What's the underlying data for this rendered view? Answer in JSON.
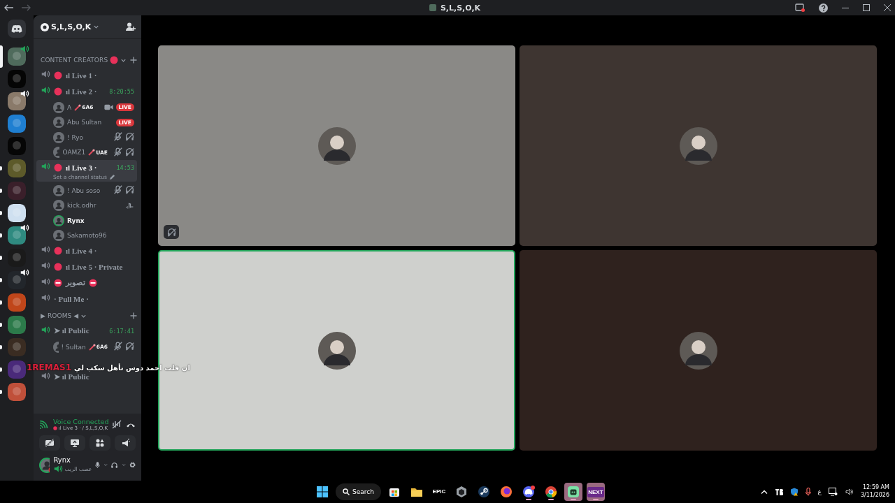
{
  "window": {
    "title": "S,L,S,O,K"
  },
  "server_rail": [
    {
      "color": "#4f6b5c",
      "selected": true,
      "unread": false,
      "voice": true
    },
    {
      "color": "#050505",
      "selected": false,
      "unread": false,
      "voice": false
    },
    {
      "color": "#8a7a6a",
      "selected": false,
      "unread": false,
      "voice": true
    },
    {
      "color": "#1f7fd1",
      "selected": false,
      "unread": false,
      "voice": false
    },
    {
      "color": "#060606",
      "selected": false,
      "unread": false,
      "voice": false
    },
    {
      "color": "#5d5a2a",
      "selected": false,
      "unread": true,
      "voice": false
    },
    {
      "color": "#3a1f2a",
      "selected": false,
      "unread": true,
      "voice": false
    },
    {
      "color": "#cfe0f0",
      "selected": false,
      "unread": true,
      "voice": false
    },
    {
      "color": "#2f8a80",
      "selected": false,
      "unread": true,
      "voice": true
    },
    {
      "color": "#1a1a1a",
      "selected": false,
      "unread": true,
      "voice": false
    },
    {
      "color": "#22262b",
      "selected": false,
      "unread": true,
      "voice": true
    },
    {
      "color": "#c0461a",
      "selected": false,
      "unread": true,
      "voice": false
    },
    {
      "color": "#2c7a4a",
      "selected": false,
      "unread": true,
      "voice": false
    },
    {
      "color": "#3a2c22",
      "selected": false,
      "unread": true,
      "voice": false
    },
    {
      "color": "#4a2a7a",
      "selected": false,
      "unread": true,
      "voice": false
    },
    {
      "color": "#c0503a",
      "selected": false,
      "unread": true,
      "voice": false
    }
  ],
  "server": {
    "name": "S,L,S,O,K"
  },
  "categories": [
    {
      "name": "CONTENT CREATORS",
      "dot": true,
      "channels": [
        {
          "kind": "voice",
          "name": "ıl Live 1 ·",
          "dot": true,
          "no_entry": false,
          "active": false,
          "selected": false
        },
        {
          "kind": "voice",
          "name": "ıl Live 2 ·",
          "dot": true,
          "no_entry": false,
          "active": true,
          "selected": false,
          "timer": "8:20:55",
          "members": [
            {
              "name": "A",
              "tag": "6A6",
              "video": true,
              "badge": "LIVE",
              "muted": false,
              "deafened": false,
              "console": false,
              "speaking": false
            },
            {
              "name": "Abu Sultan",
              "badge": "LIVE",
              "video": false,
              "muted": false,
              "deafened": false,
              "console": false,
              "speaking": false
            },
            {
              "name": "! Ryo",
              "video": false,
              "muted": true,
              "deafened": true,
              "console": false,
              "speaking": false
            },
            {
              "name": "OAMZ1",
              "tag": "UAE",
              "video": false,
              "muted": true,
              "deafened": true,
              "console": false,
              "speaking": false
            }
          ]
        },
        {
          "kind": "voice",
          "name": "ıl Live 3 ·",
          "dot": true,
          "no_entry": false,
          "active": true,
          "selected": true,
          "timer": "14:53",
          "status": "Set a channel status",
          "members": [
            {
              "name": "! Abu soso",
              "video": false,
              "muted": true,
              "deafened": true,
              "console": false,
              "speaking": false
            },
            {
              "name": "kick.odhr",
              "video": false,
              "muted": false,
              "deafened": false,
              "console": true,
              "speaking": false
            },
            {
              "name": "Rynx",
              "video": false,
              "muted": false,
              "deafened": false,
              "console": false,
              "speaking": true
            },
            {
              "name": "Sakamoto96",
              "video": false,
              "muted": false,
              "deafened": false,
              "console": false,
              "speaking": false
            }
          ]
        },
        {
          "kind": "voice",
          "name": "ıl Live 4 ·",
          "dot": true,
          "no_entry": false,
          "active": false,
          "selected": false
        },
        {
          "kind": "voice",
          "name": "ıl Live 5 · Private",
          "dot": true,
          "no_entry": false,
          "active": false,
          "selected": false
        },
        {
          "kind": "voice",
          "name": "تصوير",
          "dot": false,
          "no_entry": true,
          "active": false,
          "selected": false
        },
        {
          "kind": "voice",
          "name": "· Pull Me ·",
          "dot": false,
          "no_entry": false,
          "active": false,
          "selected": false
        }
      ]
    },
    {
      "name": "▶ ROOMS ◀",
      "dot": false,
      "channels": [
        {
          "kind": "voice",
          "name": "➤ ıl Public",
          "dot": false,
          "no_entry": false,
          "active": true,
          "selected": false,
          "timer": "6:17:41",
          "members": [
            {
              "name": "! Sultan",
              "tag": "6A6",
              "video": false,
              "muted": true,
              "deafened": true,
              "console": false,
              "speaking": false
            }
          ]
        },
        {
          "kind": "covered"
        },
        {
          "kind": "voice",
          "name": "➤ ıl Public",
          "dot": false,
          "no_entry": false,
          "active": false,
          "selected": false
        }
      ]
    }
  ],
  "overlay": {
    "tag": "1REMAS1",
    "text": "ان قلت احمد دوس تأهل سكب لي"
  },
  "voice_panel": {
    "title": "Voice Connected",
    "channel": "ıl Live 3 · / S,L,S,O,K"
  },
  "user": {
    "name": "Rynx",
    "status": "عصب الريب"
  },
  "tiles": [
    {
      "color": "#8a8986",
      "speaking": false,
      "muted": true
    },
    {
      "color": "#3e3531",
      "speaking": false,
      "muted": false
    },
    {
      "color": "#cfd0cd",
      "speaking": true,
      "muted": false
    },
    {
      "color": "#2f221e",
      "speaking": false,
      "muted": false
    }
  ],
  "taskbar": {
    "search": "Search",
    "apps": [
      {
        "kind": "store",
        "running": false,
        "selected": false
      },
      {
        "kind": "folder",
        "running": false,
        "selected": false
      },
      {
        "kind": "epic",
        "label": "EPIC",
        "running": false,
        "selected": false
      },
      {
        "kind": "cube",
        "running": false,
        "selected": false
      },
      {
        "kind": "steam",
        "running": false,
        "selected": false
      },
      {
        "kind": "firefox",
        "running": false,
        "selected": false
      },
      {
        "kind": "discord",
        "running": true,
        "selected": false,
        "badge": true
      },
      {
        "kind": "chrome",
        "running": true,
        "selected": false
      },
      {
        "kind": "app",
        "running": true,
        "selected": true
      },
      {
        "kind": "next",
        "label": "NEXT",
        "running": true,
        "selected": true
      }
    ],
    "language": "ع",
    "time": "12:59 AM",
    "date": "3/11/2026"
  }
}
